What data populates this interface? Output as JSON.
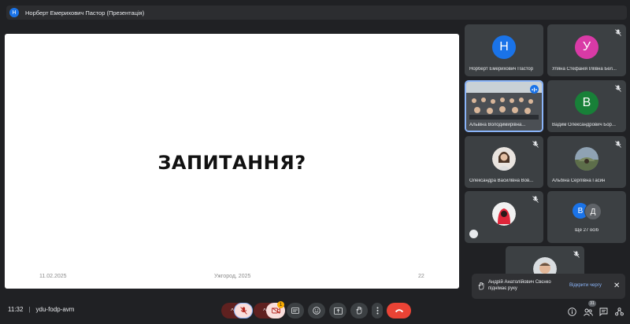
{
  "top": {
    "avatar_letter": "Н",
    "title": "Норберт Емерихович Пастор (Презентація)"
  },
  "slide": {
    "heading": "ЗАПИТАННЯ?",
    "date": "11.02.2025",
    "place": "Ужгород, 2025",
    "page": "22"
  },
  "participants": [
    {
      "name": "Норберт Емерихович Пастор",
      "letter": "Н",
      "color": "#1a73e8",
      "muted": false
    },
    {
      "name": "Уляна Стефанія Іліївна Бел...",
      "letter": "У",
      "color": "#d93aa6",
      "muted": true
    },
    {
      "name": "Альвіна Володимирівна...",
      "letter": "",
      "color": "",
      "muted": false,
      "speaking": true
    },
    {
      "name": "Вадим Олександрович Бор...",
      "letter": "В",
      "color": "#188038",
      "muted": true
    },
    {
      "name": "Олександра Василівна Вов...",
      "letter": "",
      "color": "",
      "muted": true
    },
    {
      "name": "Альбіна Сергіївна Гасин",
      "letter": "",
      "color": "",
      "muted": true
    },
    {
      "name": "",
      "letter": "",
      "color": "",
      "muted": true
    },
    {
      "name": "Ще 27 осіб",
      "letter": "В",
      "letter2": "Д",
      "color": "#1a73e8",
      "color2": "#5f6368",
      "muted": false
    },
    {
      "name": "",
      "letter": "",
      "color": "",
      "muted": true
    }
  ],
  "bottom": {
    "time": "11:32",
    "meeting_code": "ydu-fodp-avm",
    "badge_count": "1",
    "people_count": "31"
  },
  "toast": {
    "text": "Андрій Анатолійович Свєнко піднімає руку",
    "action": "Відкрити чергу"
  }
}
